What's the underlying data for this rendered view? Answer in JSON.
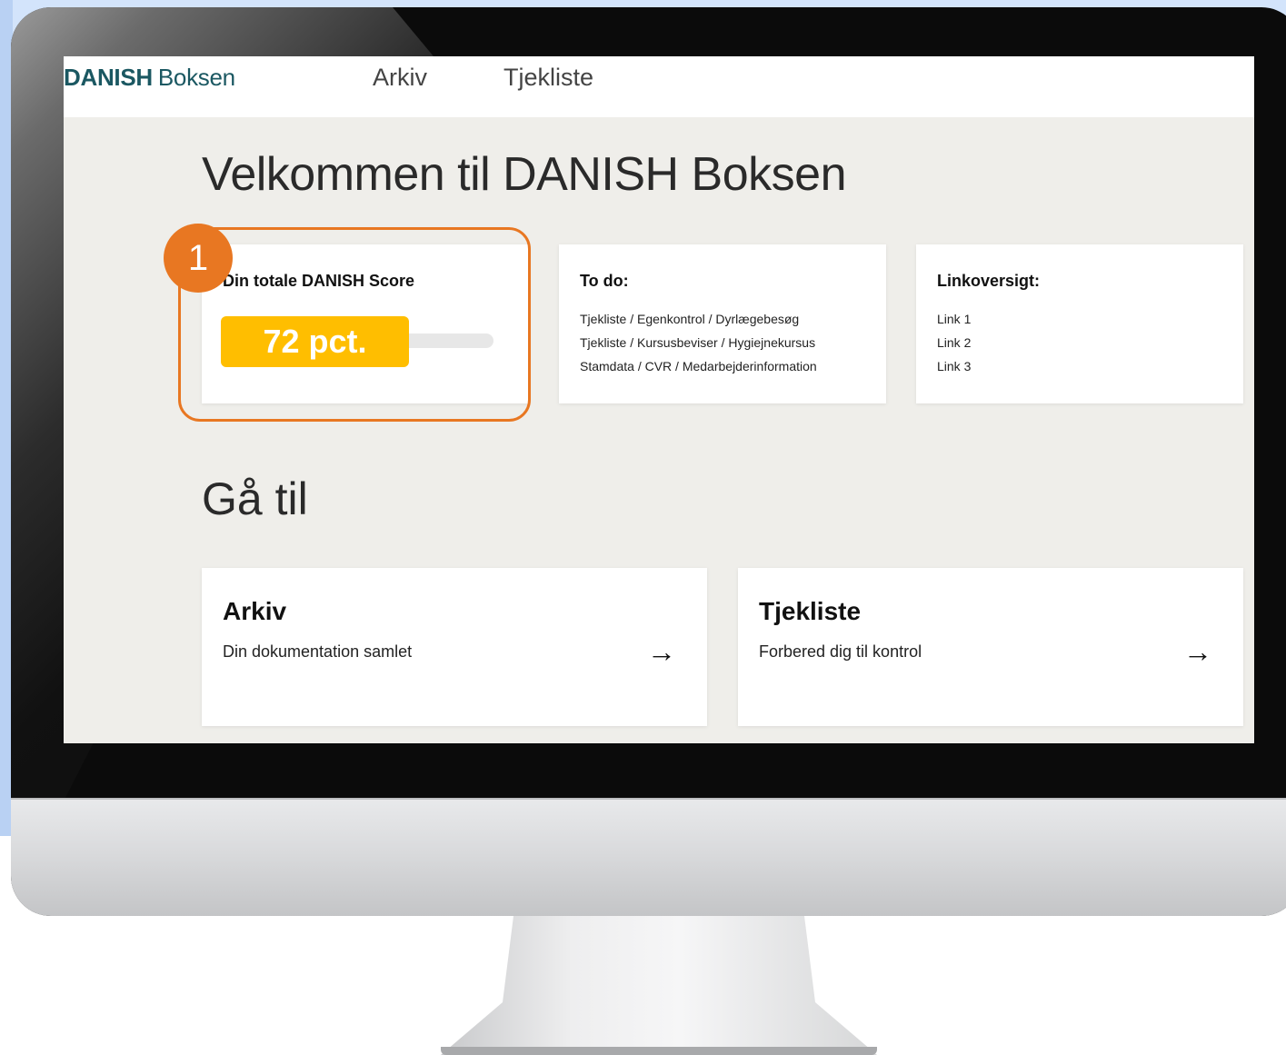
{
  "header": {
    "brand_bold": "DANISH",
    "brand_light": "Boksen",
    "nav": [
      "Arkiv",
      "Tjekliste"
    ]
  },
  "main": {
    "welcome": "Velkommen til DANISH Boksen",
    "score_card": {
      "title": "Din totale DANISH Score",
      "value_label": "72 pct.",
      "value_percent": 72,
      "badge": "1"
    },
    "todo_card": {
      "title": "To do:",
      "items": [
        "Tjekliste / Egenkontrol / Dyrlægebesøg",
        "Tjekliste / Kursusbeviser / Hygiejnekursus",
        "Stamdata / CVR / Medarbejderinformation"
      ]
    },
    "links_card": {
      "title": "Linkoversigt:",
      "items": [
        "Link 1",
        "Link 2",
        "Link 3"
      ]
    },
    "goto_heading": "Gå til",
    "goto_cards": [
      {
        "title": "Arkiv",
        "subtitle": "Din dokumentation samlet",
        "arrow": "→"
      },
      {
        "title": "Tjekliste",
        "subtitle": "Forbered dig til kontrol",
        "arrow": "→"
      }
    ]
  },
  "colors": {
    "brand": "#1b5862",
    "accent": "#e87722",
    "score_fill": "#ffbe00",
    "screen_bg": "#efeeea"
  }
}
